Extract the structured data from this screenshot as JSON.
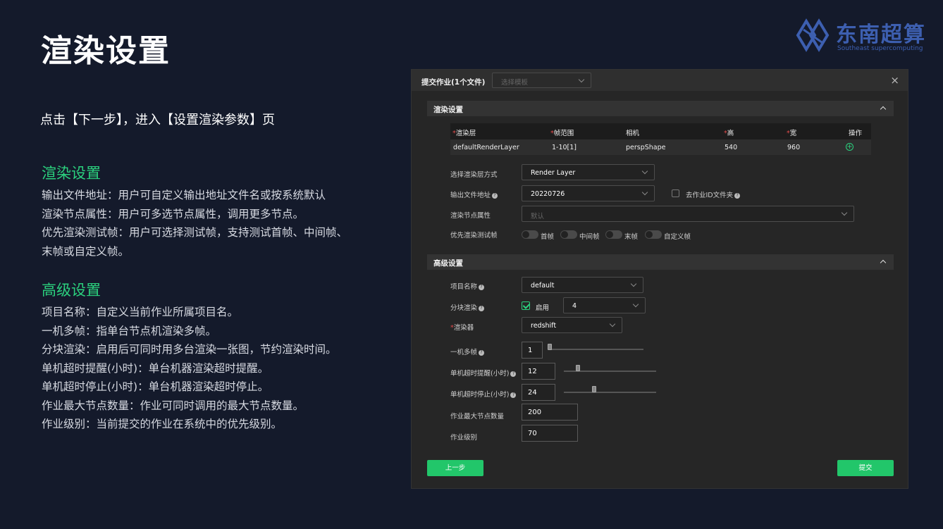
{
  "slide": {
    "title": "渲染设置",
    "intro": "点击【下一步】，进入【设置渲染参数】页"
  },
  "logo": {
    "name": "东南超算",
    "sub": "Southeast supercomputing"
  },
  "section1": {
    "heading": "渲染设置",
    "lines": [
      "输出文件地址：用户可自定义输出地址文件名或按系统默认",
      "渲染节点属性：用户可多选节点属性，调用更多节点。",
      "优先渲染测试帧：用户可选择测试帧，支持测试首帧、中间帧、",
      "末帧或自定义帧。"
    ]
  },
  "section2": {
    "heading": "高级设置",
    "lines": [
      "项目名称：自定义当前作业所属项目名。",
      "一机多帧：指单台节点机渲染多帧。",
      "分块渲染：启用后可同时用多台渲染一张图，节约渲染时间。",
      "单机超时提醒(小时)：单台机器渲染超时提醒。",
      "单机超时停止(小时)：单台机器渲染超时停止。",
      "作业最大节点数量：作业可同时调用的最大节点数量。",
      "作业级别：当前提交的作业在系统中的优先级别。"
    ]
  },
  "dialog": {
    "title": "提交作业(1个文件)",
    "template_placeholder": "选择模板",
    "close": "×",
    "render_panel": "渲染设置",
    "advanced_panel": "高级设置",
    "table": {
      "headers": [
        "渲染层",
        "帧范围",
        "相机",
        "高",
        "宽",
        "操作"
      ],
      "row": [
        "defaultRenderLayer",
        "1-10[1]",
        "perspShape",
        "540",
        "960"
      ]
    },
    "layer_mode_label": "选择渲染层方式",
    "layer_mode_value": "Render Layer",
    "output_label": "输出文件地址",
    "output_value": "20220726",
    "remove_id_folder": "去作业ID文件夹",
    "node_attr_label": "渲染节点属性",
    "node_attr_placeholder": "默认",
    "test_frame_label": "优先渲染测试帧",
    "test_frames": [
      "首帧",
      "中间帧",
      "末帧",
      "自定义帧"
    ],
    "project_label": "项目名称",
    "project_value": "default",
    "tile_label": "分块渲染",
    "tile_enable": "启用",
    "tile_count": "4",
    "renderer_label": "渲染器",
    "renderer_value": "redshift",
    "multi_frame_label": "一机多帧",
    "multi_frame_value": "1",
    "timeout_warn_label": "单机超时提醒(小时)",
    "timeout_warn_value": "12",
    "timeout_stop_label": "单机超时停止(小时)",
    "timeout_stop_value": "24",
    "max_nodes_label": "作业最大节点数量",
    "max_nodes_value": "200",
    "priority_label": "作业级别",
    "priority_value": "70",
    "prev_button": "上一步",
    "submit_button": "提交"
  }
}
